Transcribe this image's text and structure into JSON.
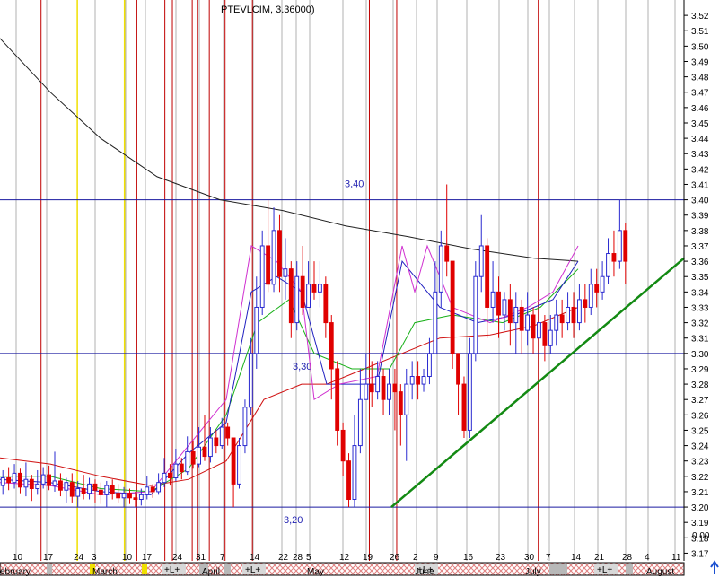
{
  "chart_data": {
    "type": "candlestick",
    "title": "PTEVLCIM, 3.36000)",
    "y_axis": {
      "ylim": [
        3.165,
        3.53
      ],
      "ticks": [
        "3.52",
        "3.51",
        "3.50",
        "3.49",
        "3.48",
        "3.47",
        "3.46",
        "3.45",
        "3.44",
        "3.43",
        "3.42",
        "3.41",
        "3.40",
        "3.39",
        "3.38",
        "3.37",
        "3.36",
        "3.35",
        "3.34",
        "3.33",
        "3.32",
        "3.31",
        "3.30",
        "3.29",
        "3.28",
        "3.27",
        "3.26",
        "3.25",
        "3.24",
        "3.23",
        "3.22",
        "3.21",
        "3.20",
        "3.19",
        "3.18",
        "3.17"
      ],
      "bottom_label": "0.00",
      "position": "right"
    },
    "x_axis": {
      "day_labels": [
        "10",
        "17",
        "24",
        "3",
        "10",
        "17",
        "24",
        "31",
        "7",
        "14",
        "22",
        "28",
        "5",
        "12",
        "19",
        "26",
        "2",
        "9",
        "16",
        "23",
        "30",
        "7",
        "14",
        "21",
        "28",
        "4",
        "11"
      ],
      "month_labels": [
        "ebruary",
        "March",
        "April",
        "May",
        "June",
        "July",
        "August"
      ]
    },
    "horizontal_lines": [
      {
        "value": 3.4,
        "label": "3,40"
      },
      {
        "value": 3.3,
        "label": "3,30"
      },
      {
        "value": 3.2,
        "label": "3,20"
      }
    ],
    "trendline": {
      "from": [
        "May 12",
        3.2
      ],
      "to": [
        "Aug 4",
        3.362
      ],
      "color": "#138a13"
    },
    "candles": [
      [
        3.214,
        3.219,
        3.224,
        3.208
      ],
      [
        3.219,
        3.216,
        3.226,
        3.211
      ],
      [
        3.216,
        3.222,
        3.228,
        3.212
      ],
      [
        3.222,
        3.213,
        3.225,
        3.209
      ],
      [
        3.213,
        3.218,
        3.229,
        3.207
      ],
      [
        3.218,
        3.212,
        3.221,
        3.204
      ],
      [
        3.212,
        3.215,
        3.224,
        3.208
      ],
      [
        3.215,
        3.221,
        3.226,
        3.212
      ],
      [
        3.221,
        3.214,
        3.227,
        3.211
      ],
      [
        3.214,
        3.217,
        3.236,
        3.21
      ],
      [
        3.217,
        3.211,
        3.222,
        3.207
      ],
      [
        3.211,
        3.216,
        3.219,
        3.203
      ],
      [
        3.216,
        3.207,
        3.222,
        3.203
      ],
      [
        3.207,
        3.212,
        3.217,
        3.2
      ],
      [
        3.212,
        3.209,
        3.221,
        3.205
      ],
      [
        3.209,
        3.215,
        3.219,
        3.205
      ],
      [
        3.215,
        3.211,
        3.218,
        3.203
      ],
      [
        3.211,
        3.208,
        3.216,
        3.202
      ],
      [
        3.208,
        3.214,
        3.217,
        3.2
      ],
      [
        3.214,
        3.209,
        3.218,
        3.205
      ],
      [
        3.209,
        3.206,
        3.215,
        3.203
      ],
      [
        3.206,
        3.209,
        3.213,
        3.2
      ],
      [
        3.209,
        3.206,
        3.212,
        3.202
      ],
      [
        3.206,
        3.205,
        3.21,
        3.2
      ],
      [
        3.205,
        3.208,
        3.212,
        3.201
      ],
      [
        3.208,
        3.213,
        3.22,
        3.205
      ],
      [
        3.213,
        3.21,
        3.215,
        3.206
      ],
      [
        3.21,
        3.216,
        3.222,
        3.208
      ],
      [
        3.216,
        3.222,
        3.232,
        3.213
      ],
      [
        3.222,
        3.219,
        3.228,
        3.214
      ],
      [
        3.219,
        3.228,
        3.238,
        3.217
      ],
      [
        3.228,
        3.223,
        3.232,
        3.218
      ],
      [
        3.223,
        3.236,
        3.246,
        3.221
      ],
      [
        3.236,
        3.228,
        3.243,
        3.225
      ],
      [
        3.228,
        3.239,
        3.252,
        3.226
      ],
      [
        3.239,
        3.233,
        3.26,
        3.23
      ],
      [
        3.233,
        3.245,
        3.252,
        3.229
      ],
      [
        3.245,
        3.24,
        3.25,
        3.235
      ],
      [
        3.24,
        3.252,
        3.258,
        3.238
      ],
      [
        3.252,
        3.245,
        3.255,
        3.24
      ],
      [
        3.245,
        3.215,
        3.245,
        3.2
      ],
      [
        3.215,
        3.24,
        3.245,
        3.212
      ],
      [
        3.24,
        3.265,
        3.27,
        3.235
      ],
      [
        3.265,
        3.3,
        3.31,
        3.26
      ],
      [
        3.3,
        3.33,
        3.35,
        3.29
      ],
      [
        3.33,
        3.37,
        3.38,
        3.325
      ],
      [
        3.37,
        3.345,
        3.4,
        3.34
      ],
      [
        3.345,
        3.38,
        3.395,
        3.34
      ],
      [
        3.38,
        3.35,
        3.39,
        3.34
      ],
      [
        3.35,
        3.355,
        3.375,
        3.335
      ],
      [
        3.355,
        3.32,
        3.36,
        3.31
      ],
      [
        3.32,
        3.35,
        3.36,
        3.315
      ],
      [
        3.35,
        3.33,
        3.37,
        3.325
      ],
      [
        3.33,
        3.345,
        3.36,
        3.33
      ],
      [
        3.345,
        3.34,
        3.36,
        3.335
      ],
      [
        3.34,
        3.345,
        3.36,
        3.33
      ],
      [
        3.345,
        3.32,
        3.35,
        3.31
      ],
      [
        3.32,
        3.29,
        3.325,
        3.27
      ],
      [
        3.29,
        3.25,
        3.295,
        3.24
      ],
      [
        3.25,
        3.23,
        3.255,
        3.22
      ],
      [
        3.23,
        3.205,
        3.235,
        3.2
      ],
      [
        3.205,
        3.24,
        3.26,
        3.2
      ],
      [
        3.24,
        3.27,
        3.29,
        3.235
      ],
      [
        3.27,
        3.28,
        3.3,
        3.27
      ],
      [
        3.28,
        3.275,
        3.295,
        3.265
      ],
      [
        3.275,
        3.285,
        3.295,
        3.27
      ],
      [
        3.285,
        3.27,
        3.29,
        3.26
      ],
      [
        3.27,
        3.28,
        3.29,
        3.26
      ],
      [
        3.28,
        3.275,
        3.29,
        3.25
      ],
      [
        3.275,
        3.26,
        3.28,
        3.24
      ],
      [
        3.26,
        3.28,
        3.29,
        3.23
      ],
      [
        3.28,
        3.285,
        3.295,
        3.27
      ],
      [
        3.285,
        3.28,
        3.295,
        3.27
      ],
      [
        3.28,
        3.285,
        3.29,
        3.275
      ],
      [
        3.285,
        3.3,
        3.31,
        3.28
      ],
      [
        3.3,
        3.34,
        3.36,
        3.3
      ],
      [
        3.34,
        3.37,
        3.38,
        3.33
      ],
      [
        3.37,
        3.36,
        3.41,
        3.35
      ],
      [
        3.36,
        3.3,
        3.36,
        3.29
      ],
      [
        3.3,
        3.28,
        3.3,
        3.26
      ],
      [
        3.28,
        3.25,
        3.285,
        3.245
      ],
      [
        3.25,
        3.3,
        3.31,
        3.245
      ],
      [
        3.3,
        3.35,
        3.36,
        3.295
      ],
      [
        3.35,
        3.37,
        3.39,
        3.34
      ],
      [
        3.37,
        3.33,
        3.375,
        3.31
      ],
      [
        3.33,
        3.34,
        3.36,
        3.32
      ],
      [
        3.34,
        3.325,
        3.35,
        3.31
      ],
      [
        3.325,
        3.335,
        3.34,
        3.315
      ],
      [
        3.335,
        3.32,
        3.345,
        3.305
      ],
      [
        3.32,
        3.33,
        3.34,
        3.3
      ],
      [
        3.33,
        3.315,
        3.335,
        3.3
      ],
      [
        3.315,
        3.325,
        3.34,
        3.305
      ],
      [
        3.325,
        3.31,
        3.33,
        3.3
      ],
      [
        3.31,
        3.32,
        3.335,
        3.3
      ],
      [
        3.32,
        3.305,
        3.325,
        3.295
      ],
      [
        3.305,
        3.315,
        3.325,
        3.3
      ],
      [
        3.315,
        3.325,
        3.335,
        3.305
      ],
      [
        3.325,
        3.32,
        3.335,
        3.31
      ],
      [
        3.32,
        3.33,
        3.34,
        3.315
      ],
      [
        3.33,
        3.32,
        3.34,
        3.31
      ],
      [
        3.32,
        3.335,
        3.345,
        3.315
      ],
      [
        3.335,
        3.33,
        3.345,
        3.32
      ],
      [
        3.33,
        3.345,
        3.355,
        3.325
      ],
      [
        3.345,
        3.34,
        3.355,
        3.33
      ],
      [
        3.34,
        3.35,
        3.36,
        3.335
      ],
      [
        3.35,
        3.365,
        3.375,
        3.345
      ],
      [
        3.365,
        3.36,
        3.38,
        3.35
      ],
      [
        3.36,
        3.38,
        3.4,
        3.355
      ],
      [
        3.38,
        3.36,
        3.385,
        3.345
      ]
    ],
    "moving_averages": [
      {
        "color": "#202020",
        "points": [
          [
            0,
            3.505
          ],
          [
            0.08,
            3.47
          ],
          [
            0.16,
            3.44
          ],
          [
            0.25,
            3.415
          ],
          [
            0.35,
            3.4
          ],
          [
            0.45,
            3.393
          ],
          [
            0.55,
            3.383
          ],
          [
            0.65,
            3.376
          ],
          [
            0.75,
            3.368
          ],
          [
            0.85,
            3.362
          ],
          [
            0.92,
            3.36
          ]
        ]
      },
      {
        "color": "#d01010",
        "points": [
          [
            0,
            3.232
          ],
          [
            0.08,
            3.228
          ],
          [
            0.16,
            3.22
          ],
          [
            0.24,
            3.214
          ],
          [
            0.3,
            3.218
          ],
          [
            0.36,
            3.23
          ],
          [
            0.42,
            3.27
          ],
          [
            0.48,
            3.28
          ],
          [
            0.52,
            3.28
          ],
          [
            0.58,
            3.29
          ],
          [
            0.64,
            3.3
          ],
          [
            0.7,
            3.31
          ],
          [
            0.78,
            3.312
          ],
          [
            0.85,
            3.318
          ],
          [
            0.92,
            3.33
          ]
        ]
      },
      {
        "color": "#18b018",
        "points": [
          [
            0,
            3.22
          ],
          [
            0.08,
            3.22
          ],
          [
            0.16,
            3.212
          ],
          [
            0.24,
            3.21
          ],
          [
            0.3,
            3.225
          ],
          [
            0.36,
            3.26
          ],
          [
            0.41,
            3.32
          ],
          [
            0.46,
            3.335
          ],
          [
            0.5,
            3.3
          ],
          [
            0.56,
            3.29
          ],
          [
            0.62,
            3.29
          ],
          [
            0.66,
            3.32
          ],
          [
            0.72,
            3.325
          ],
          [
            0.8,
            3.32
          ],
          [
            0.86,
            3.33
          ],
          [
            0.92,
            3.355
          ]
        ]
      },
      {
        "color": "#2020c0",
        "points": [
          [
            0,
            3.218
          ],
          [
            0.08,
            3.216
          ],
          [
            0.16,
            3.21
          ],
          [
            0.24,
            3.208
          ],
          [
            0.3,
            3.235
          ],
          [
            0.36,
            3.255
          ],
          [
            0.4,
            3.34
          ],
          [
            0.44,
            3.35
          ],
          [
            0.48,
            3.34
          ],
          [
            0.52,
            3.28
          ],
          [
            0.56,
            3.28
          ],
          [
            0.6,
            3.28
          ],
          [
            0.64,
            3.36
          ],
          [
            0.66,
            3.35
          ],
          [
            0.7,
            3.33
          ],
          [
            0.76,
            3.32
          ],
          [
            0.82,
            3.325
          ],
          [
            0.88,
            3.335
          ],
          [
            0.92,
            3.36
          ]
        ]
      },
      {
        "color": "#d030d0",
        "points": [
          [
            0,
            3.216
          ],
          [
            0.08,
            3.214
          ],
          [
            0.16,
            3.208
          ],
          [
            0.24,
            3.21
          ],
          [
            0.3,
            3.24
          ],
          [
            0.36,
            3.27
          ],
          [
            0.4,
            3.37
          ],
          [
            0.44,
            3.36
          ],
          [
            0.48,
            3.34
          ],
          [
            0.5,
            3.27
          ],
          [
            0.54,
            3.28
          ],
          [
            0.6,
            3.285
          ],
          [
            0.64,
            3.37
          ],
          [
            0.66,
            3.34
          ],
          [
            0.68,
            3.37
          ],
          [
            0.72,
            3.33
          ],
          [
            0.78,
            3.32
          ],
          [
            0.84,
            3.33
          ],
          [
            0.88,
            3.34
          ],
          [
            0.92,
            3.37
          ]
        ]
      }
    ],
    "colors": {
      "up": "#2a2ad0",
      "down": "#e00000",
      "hline": "#1a1aa0",
      "grid_vert": "#b0b0b0",
      "event_red": "#c00000",
      "event_yellow": "#f0e000"
    },
    "event_markers": [
      {
        "type": "yellow",
        "at": 0.113
      },
      {
        "type": "yellow",
        "at": 0.182
      },
      {
        "type": "red",
        "at": 0.06
      },
      {
        "type": "red",
        "at": 0.2
      },
      {
        "type": "red",
        "at": 0.241
      },
      {
        "type": "red",
        "at": 0.252
      },
      {
        "type": "red",
        "at": 0.281
      },
      {
        "type": "red",
        "at": 0.289
      },
      {
        "type": "red",
        "at": 0.306
      },
      {
        "type": "red",
        "at": 0.329
      },
      {
        "type": "red",
        "at": 0.369
      },
      {
        "type": "red",
        "at": 0.54
      },
      {
        "type": "red",
        "at": 0.58
      },
      {
        "type": "red",
        "at": 0.787
      }
    ],
    "bottom_strip": {
      "labels": [
        "+L+",
        "+L+",
        "+L+",
        "+L+"
      ],
      "arrow": "up-arrow"
    }
  }
}
